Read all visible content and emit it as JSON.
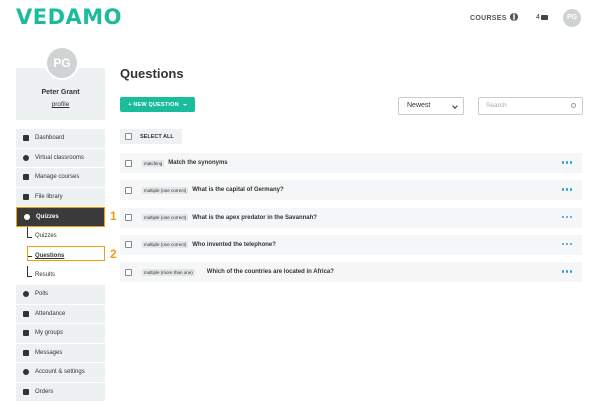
{
  "header": {
    "logo": "VEDAMO",
    "courses_label": "COURSES",
    "message_count": "4",
    "avatar_initials": "PG"
  },
  "profile": {
    "initials": "PG",
    "name": "Peter Grant",
    "link": "profile"
  },
  "sidebar": {
    "items_top": [
      {
        "label": "Dashboard",
        "icon": "grid-icon"
      },
      {
        "label": "Virtual classrooms",
        "icon": "gear-icon"
      },
      {
        "label": "Manage courses",
        "icon": "pencil-icon"
      },
      {
        "label": "File library",
        "icon": "folder-icon"
      },
      {
        "label": "Quizzes",
        "icon": "question-icon"
      }
    ],
    "sub_items": [
      {
        "label": "Quizzes"
      },
      {
        "label": "Questions"
      },
      {
        "label": "Results"
      }
    ],
    "items_bottom": [
      {
        "label": "Polls",
        "icon": "question-icon"
      },
      {
        "label": "Attendance",
        "icon": "calendar-icon"
      },
      {
        "label": "My groups",
        "icon": "users-icon"
      },
      {
        "label": "Messages",
        "icon": "envelope-icon"
      },
      {
        "label": "Account & settings",
        "icon": "gear-icon"
      },
      {
        "label": "Orders",
        "icon": "cart-icon"
      }
    ]
  },
  "callouts": [
    "1",
    "2"
  ],
  "main": {
    "title": "Questions",
    "new_button": "+ NEW QUESTION",
    "sort_value": "Newest",
    "search_placeholder": "Search",
    "select_all": "SELECT ALL",
    "questions": [
      {
        "type": "matching",
        "text": "Match the synonyms"
      },
      {
        "type": "multiple (one correct)",
        "text": "What is the capital of Germany?"
      },
      {
        "type": "multiple (one correct)",
        "text": "What is the apex predator in the Savannah?"
      },
      {
        "type": "multiple (one correct)",
        "text": "Who invented the telephone?"
      },
      {
        "type": "multiple (more than one)",
        "text": "Which of the countries are located in Africa?"
      }
    ]
  },
  "colors": {
    "brand": "#1abc9c",
    "highlight": "#f39c12",
    "more_dots": "#3498db",
    "active_bg": "#3a3a3a"
  }
}
